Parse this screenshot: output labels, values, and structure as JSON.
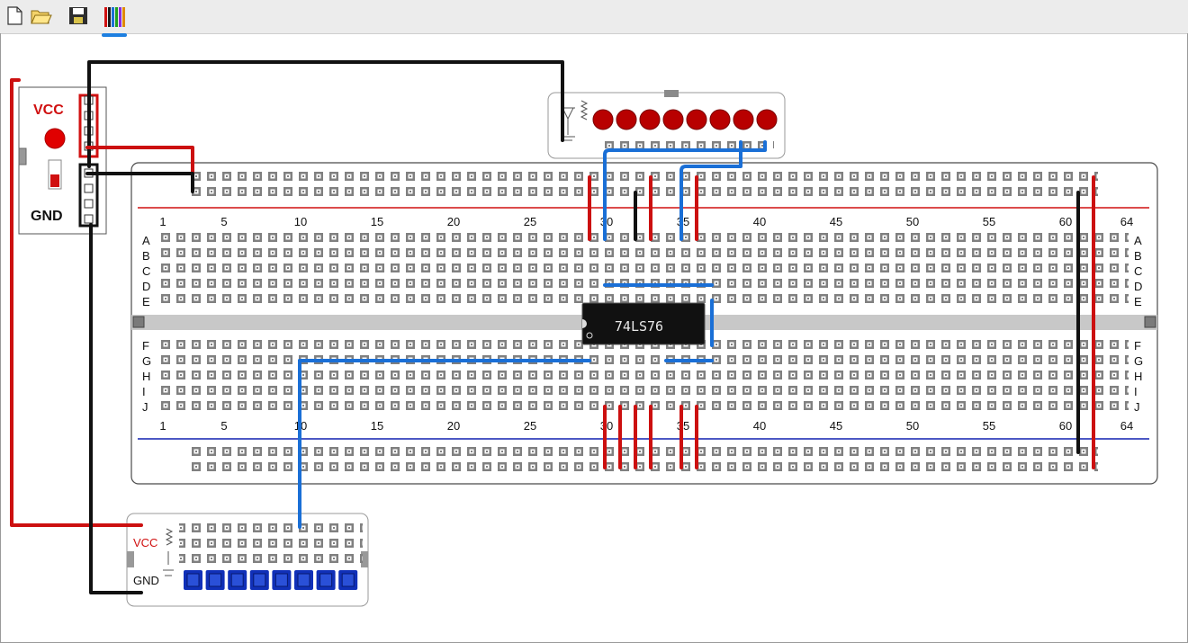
{
  "toolbar": {
    "buttons": [
      {
        "name": "new-file-button",
        "icon": "new-document-icon"
      },
      {
        "name": "open-file-button",
        "icon": "open-folder-icon"
      },
      {
        "name": "save-file-button",
        "icon": "floppy-disk-icon"
      },
      {
        "name": "wire-color-button",
        "icon": "wire-colors-icon",
        "selected": true
      }
    ]
  },
  "power_supply": {
    "vcc_label": "VCC",
    "gnd_label": "GND"
  },
  "breadboard": {
    "top_rows": [
      "A",
      "B",
      "C",
      "D",
      "E"
    ],
    "bottom_rows": [
      "F",
      "G",
      "H",
      "I",
      "J"
    ],
    "column_numbers": [
      "1",
      "5",
      "10",
      "15",
      "20",
      "25",
      "30",
      "35",
      "40",
      "45",
      "50",
      "55",
      "60",
      "64"
    ],
    "columns": 64
  },
  "chip": {
    "label": "74LS76"
  },
  "switch_module": {
    "vcc_label": "VCC",
    "gnd_label": "GND"
  },
  "led_module": {
    "led_count": 8
  },
  "colors": {
    "wire_red": "#cc1010",
    "wire_black": "#111111",
    "wire_blue": "#1a6fd6",
    "led_red": "#b80000",
    "switch_blue": "#1030b8",
    "accent": "#1e7fe0"
  }
}
